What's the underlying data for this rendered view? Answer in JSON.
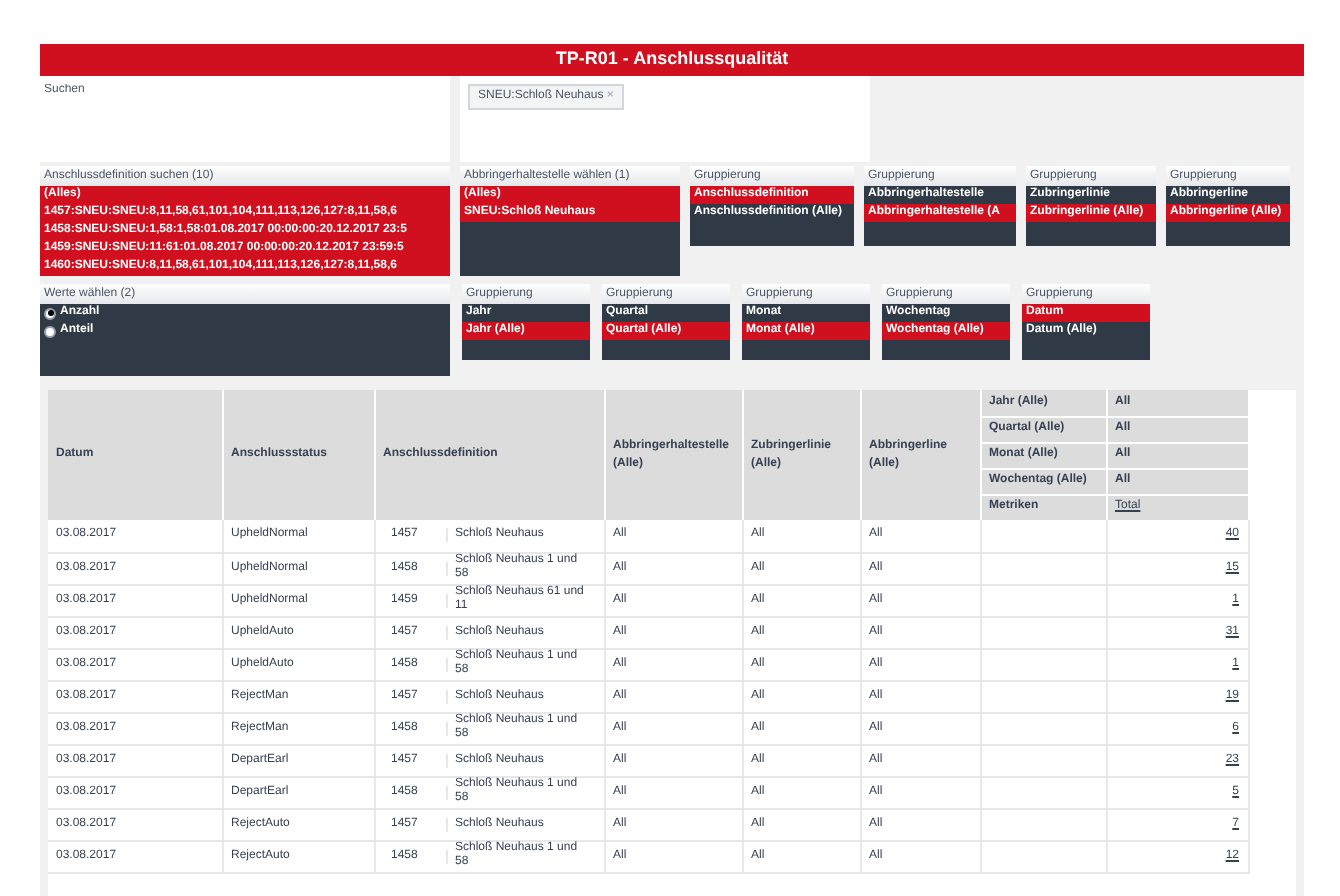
{
  "title": "TP-R01 - Anschlussqualität",
  "search": {
    "placeholder": "Suchen"
  },
  "tag_filter": {
    "tags": [
      {
        "label": "SNEU:Schloß Neuhaus",
        "remove": "×"
      }
    ]
  },
  "definition_list": {
    "title": "Anschlussdefinition suchen (10)",
    "items": [
      {
        "label": "(Alles)",
        "selected": true
      },
      {
        "label": "1457:SNEU:SNEU:8,11,58,61,101,104,111,113,126,127:8,11,58,6",
        "selected": true
      },
      {
        "label": "1458:SNEU:SNEU:1,58:1,58:01.08.2017 00:00:00:20.12.2017 23:5",
        "selected": true
      },
      {
        "label": "1459:SNEU:SNEU:11:61:01.08.2017 00:00:00:20.12.2017 23:59:5",
        "selected": true
      },
      {
        "label": "1460:SNEU:SNEU:8,11,58,61,101,104,111,113,126,127:8,11,58,6",
        "selected": true
      }
    ]
  },
  "stop_list": {
    "title": "Abbringerhaltestelle wählen (1)",
    "items": [
      {
        "label": "(Alles)",
        "selected": true
      },
      {
        "label": "SNEU:Schloß Neuhaus",
        "selected": true
      }
    ]
  },
  "groupings_top": [
    {
      "title": "Gruppierung",
      "items": [
        {
          "label": "Anschlussdefinition",
          "selected": true
        },
        {
          "label": "Anschlussdefinition (Alle)",
          "selected": false
        }
      ]
    },
    {
      "title": "Gruppierung",
      "items": [
        {
          "label": "Abbringerhaltestelle",
          "selected": false
        },
        {
          "label": "Abbringerhaltestelle (A",
          "selected": true
        }
      ]
    },
    {
      "title": "Gruppierung",
      "items": [
        {
          "label": "Zubringerlinie",
          "selected": false
        },
        {
          "label": "Zubringerlinie (Alle)",
          "selected": true
        }
      ]
    },
    {
      "title": "Gruppierung",
      "items": [
        {
          "label": "Abbringerline",
          "selected": false
        },
        {
          "label": "Abbringerline (Alle)",
          "selected": true
        }
      ]
    }
  ],
  "values": {
    "title": "Werte wählen (2)",
    "options": [
      {
        "label": "Anzahl",
        "selected": true
      },
      {
        "label": "Anteil",
        "selected": false
      }
    ]
  },
  "groupings_bottom": [
    {
      "title": "Gruppierung",
      "items": [
        {
          "label": "Jahr",
          "selected": false
        },
        {
          "label": "Jahr (Alle)",
          "selected": true
        }
      ]
    },
    {
      "title": "Gruppierung",
      "items": [
        {
          "label": "Quartal",
          "selected": false
        },
        {
          "label": "Quartal (Alle)",
          "selected": true
        }
      ]
    },
    {
      "title": "Gruppierung",
      "items": [
        {
          "label": "Monat",
          "selected": false
        },
        {
          "label": "Monat (Alle)",
          "selected": true
        }
      ]
    },
    {
      "title": "Gruppierung",
      "items": [
        {
          "label": "Wochentag",
          "selected": false
        },
        {
          "label": "Wochentag (Alle)",
          "selected": true
        }
      ]
    },
    {
      "title": "Gruppierung",
      "items": [
        {
          "label": "Datum",
          "selected": true
        },
        {
          "label": "Datum (Alle)",
          "selected": false
        }
      ]
    }
  ],
  "table": {
    "columns": [
      "Datum",
      "Anschlussstatus",
      "Anschlussdefinition",
      "Abbringerhaltestelle (Alle)",
      "Zubringerlinie (Alle)",
      "Abbringerline (Alle)"
    ],
    "filters": [
      {
        "label": "Jahr (Alle)",
        "value": "All"
      },
      {
        "label": "Quartal (Alle)",
        "value": "All"
      },
      {
        "label": "Monat (Alle)",
        "value": "All"
      },
      {
        "label": "Wochentag (Alle)",
        "value": "All"
      }
    ],
    "metrics_label": "Metriken",
    "metrics_value": "Total",
    "rows": [
      [
        "03.08.2017",
        "UpheldNormal",
        [
          "1457",
          "Schloß Neuhaus"
        ],
        "All",
        "All",
        "All",
        "",
        "40"
      ],
      [
        "03.08.2017",
        "UpheldNormal",
        [
          "1458",
          "Schloß Neuhaus 1 und 58"
        ],
        "All",
        "All",
        "All",
        "",
        "15"
      ],
      [
        "03.08.2017",
        "UpheldNormal",
        [
          "1459",
          "Schloß Neuhaus 61 und 11"
        ],
        "All",
        "All",
        "All",
        "",
        "1"
      ],
      [
        "03.08.2017",
        "UpheldAuto",
        [
          "1457",
          "Schloß Neuhaus"
        ],
        "All",
        "All",
        "All",
        "",
        "31"
      ],
      [
        "03.08.2017",
        "UpheldAuto",
        [
          "1458",
          "Schloß Neuhaus 1 und 58"
        ],
        "All",
        "All",
        "All",
        "",
        "1"
      ],
      [
        "03.08.2017",
        "RejectMan",
        [
          "1457",
          "Schloß Neuhaus"
        ],
        "All",
        "All",
        "All",
        "",
        "19"
      ],
      [
        "03.08.2017",
        "RejectMan",
        [
          "1458",
          "Schloß Neuhaus 1 und 58"
        ],
        "All",
        "All",
        "All",
        "",
        "6"
      ],
      [
        "03.08.2017",
        "DepartEarl",
        [
          "1457",
          "Schloß Neuhaus"
        ],
        "All",
        "All",
        "All",
        "",
        "23"
      ],
      [
        "03.08.2017",
        "DepartEarl",
        [
          "1458",
          "Schloß Neuhaus 1 und 58"
        ],
        "All",
        "All",
        "All",
        "",
        "5"
      ],
      [
        "03.08.2017",
        "RejectAuto",
        [
          "1457",
          "Schloß Neuhaus"
        ],
        "All",
        "All",
        "All",
        "",
        "7"
      ],
      [
        "03.08.2017",
        "RejectAuto",
        [
          "1458",
          "Schloß Neuhaus 1 und 58"
        ],
        "All",
        "All",
        "All",
        "",
        "12"
      ]
    ]
  }
}
